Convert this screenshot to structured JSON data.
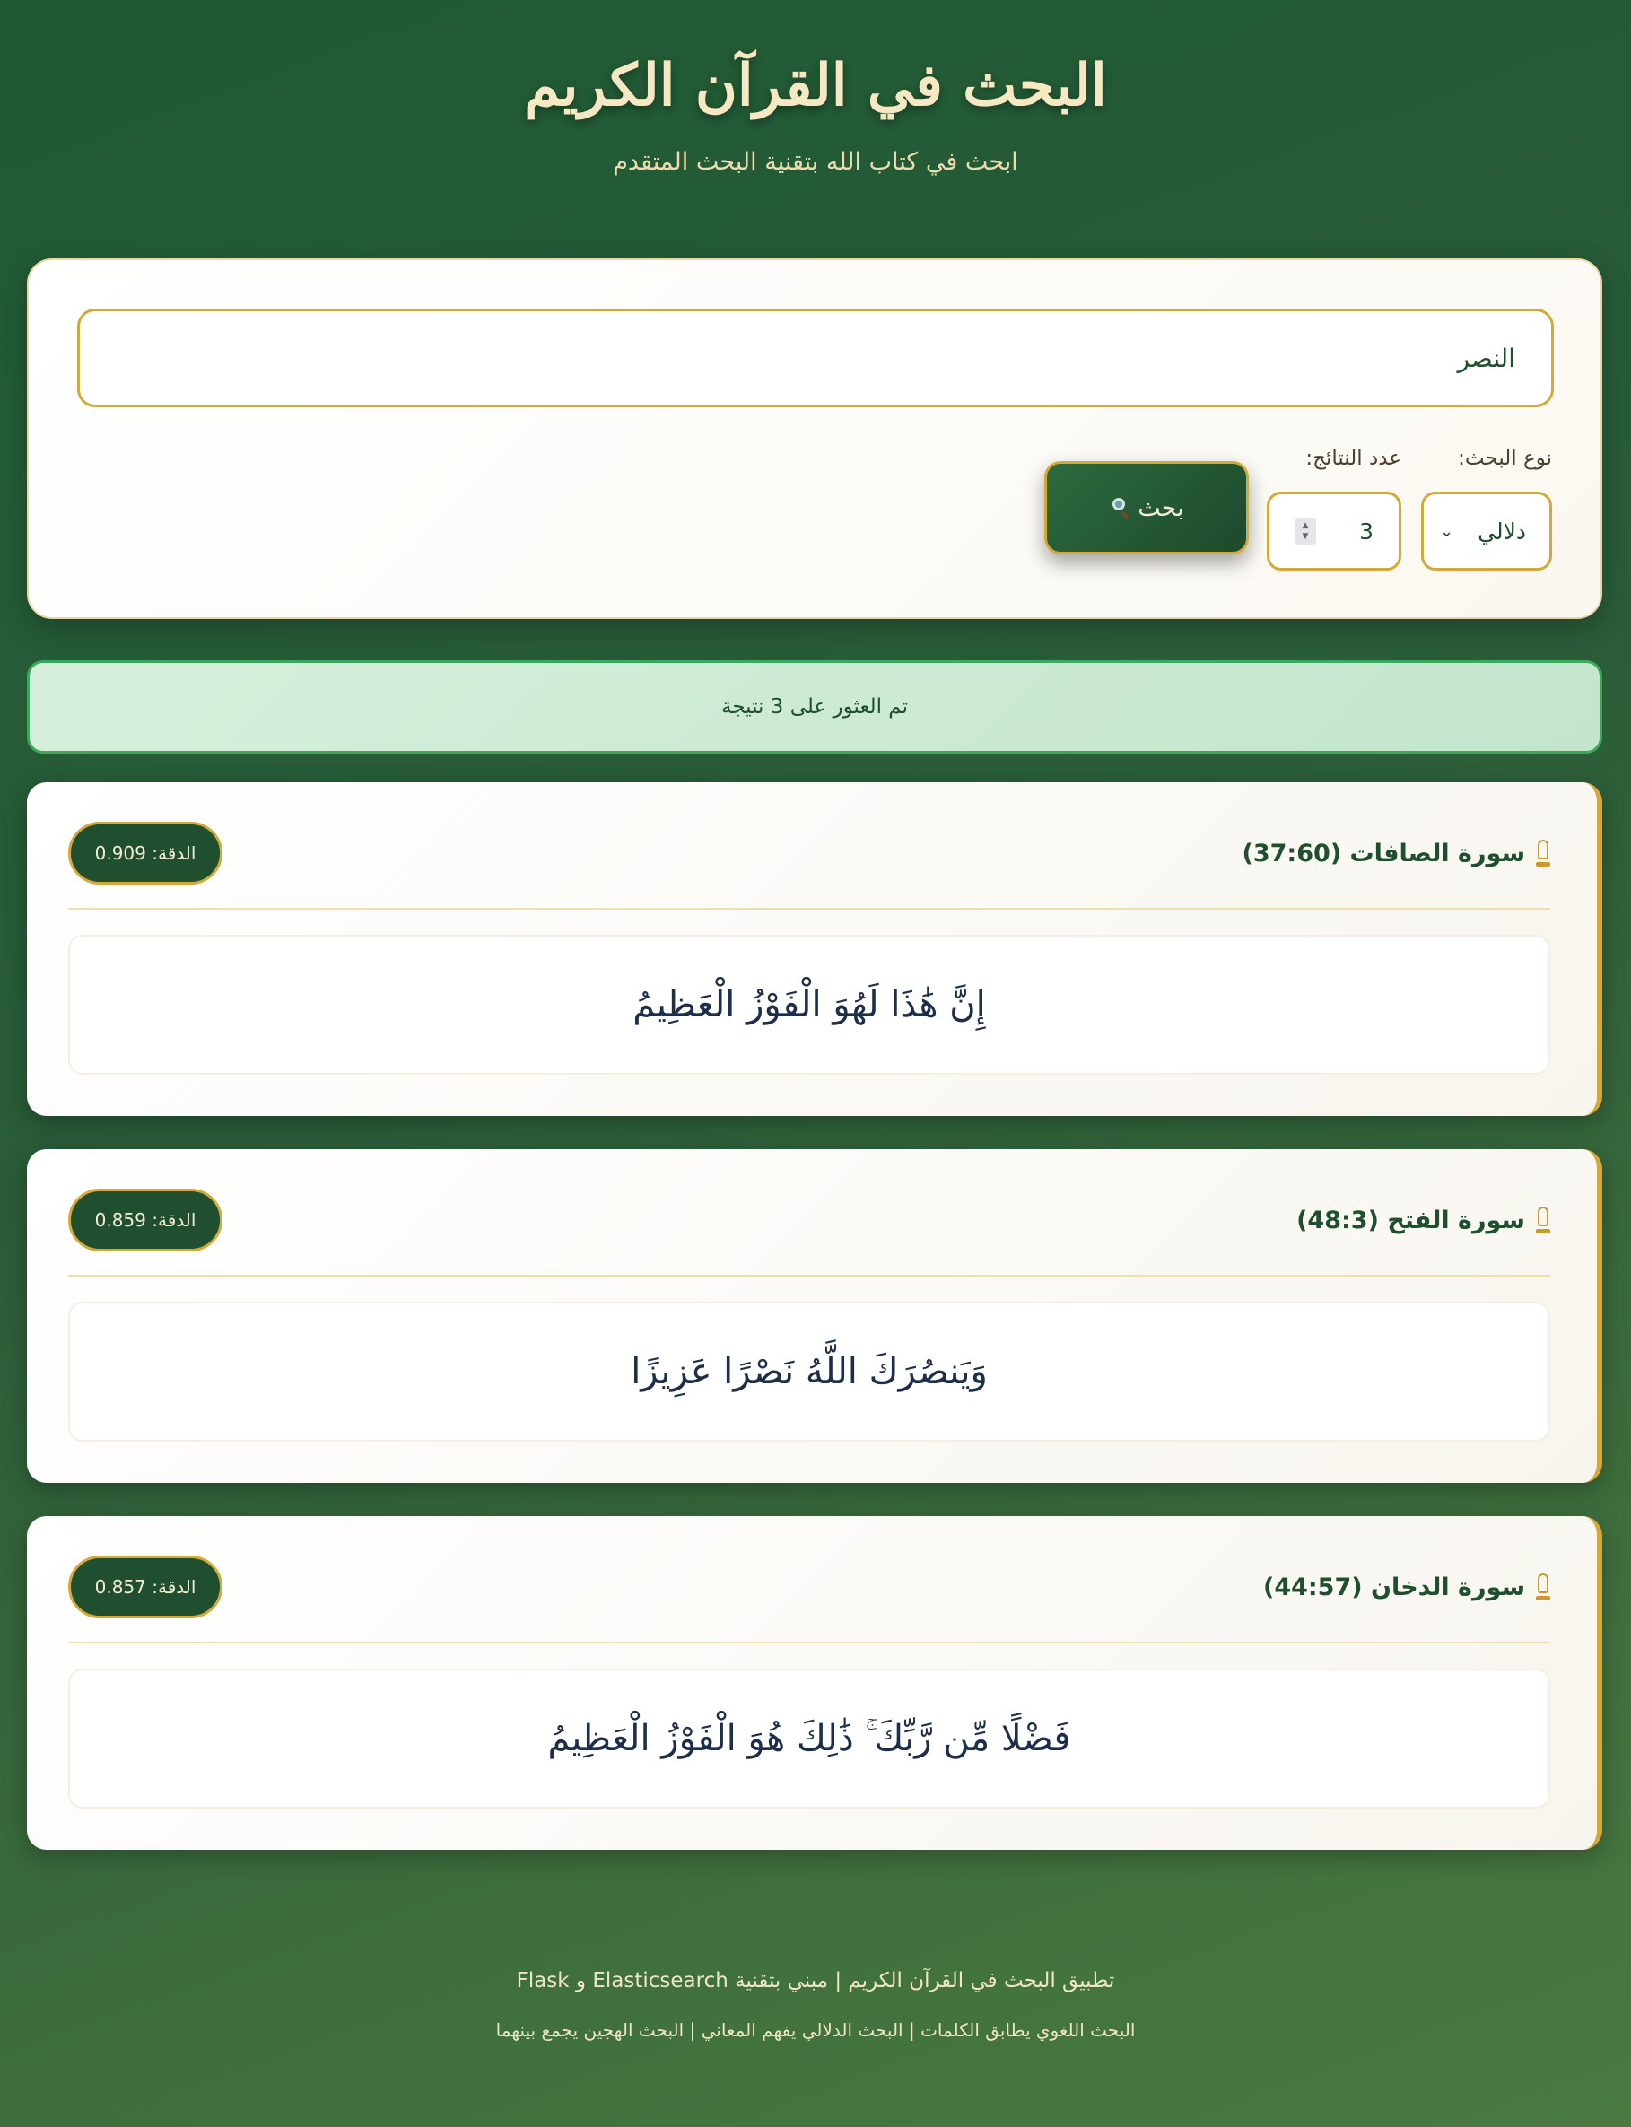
{
  "header": {
    "title": "البحث في القرآن الكريم",
    "subtitle": "ابحث في كتاب الله بتقنية البحث المتقدم"
  },
  "search": {
    "query": "النصر",
    "type_label": "نوع البحث:",
    "type_value": "دلالي",
    "count_label": "عدد النتائج:",
    "count_value": "3",
    "button_label": "بحث"
  },
  "status": {
    "message": "تم العثور على 3 نتيجة"
  },
  "results": [
    {
      "surah": "سورة الصافات (37:60)",
      "score": "الدقة: 0.909",
      "verse": "إِنَّ هَٰذَا لَهُوَ الْفَوْزُ الْعَظِيمُ"
    },
    {
      "surah": "سورة الفتح (48:3)",
      "score": "الدقة: 0.859",
      "verse": "وَيَنصُرَكَ اللَّهُ نَصْرًا عَزِيزًا"
    },
    {
      "surah": "سورة الدخان (44:57)",
      "score": "الدقة: 0.857",
      "verse": "فَضْلًا مِّن رَّبِّكَ ۚ ذَٰلِكَ هُوَ الْفَوْزُ الْعَظِيمُ"
    }
  ],
  "footer": {
    "line1": "تطبيق البحث في القرآن الكريم | مبني بتقنية Elasticsearch و Flask",
    "line2": "البحث اللغوي يطابق الكلمات | البحث الدلالي يفهم المعاني | البحث الهجين يجمع بينهما"
  },
  "colors": {
    "background": "#2a5c38",
    "gold_accent": "#d4a93a",
    "dark_green": "#1f4f2f",
    "status_green": "#3ca85c"
  },
  "icons": {
    "search_button": "magnifier-icon",
    "surah_marker": "lamp-icon",
    "select": "chevron-down-icon",
    "number": "spinner-icon"
  }
}
